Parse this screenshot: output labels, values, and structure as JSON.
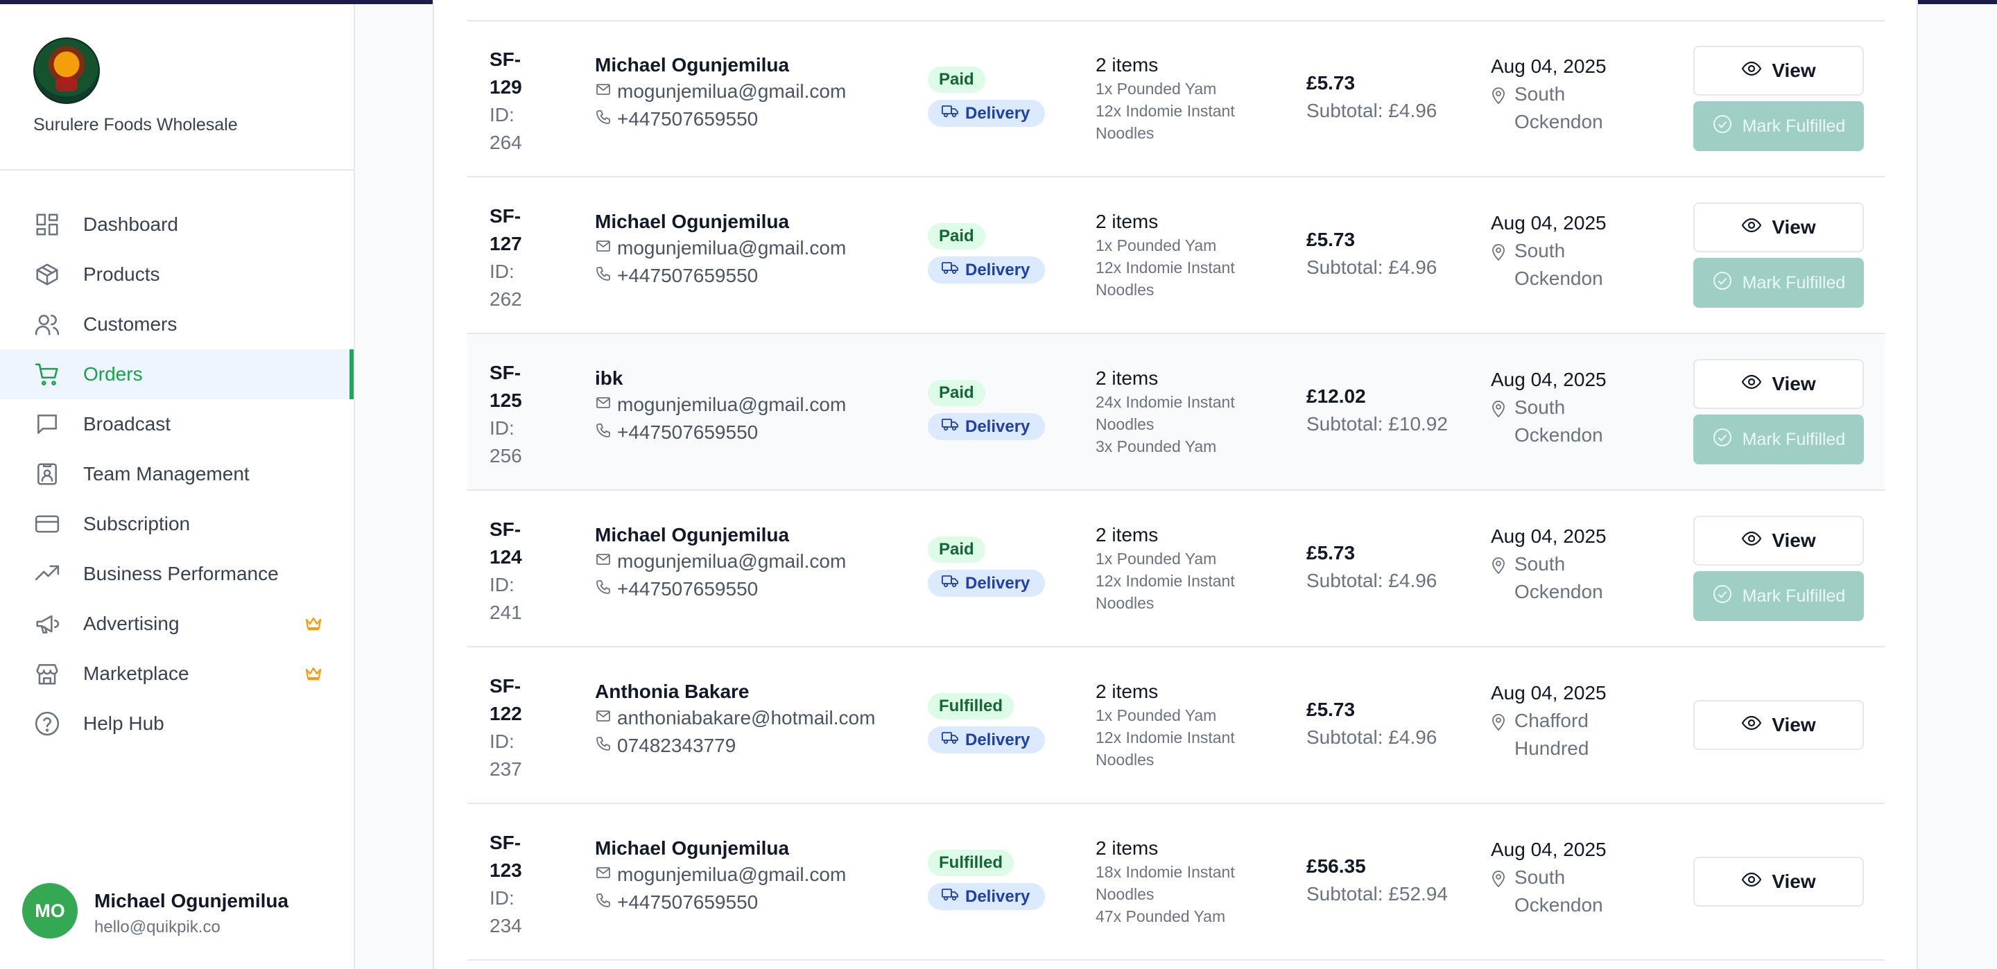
{
  "brand": {
    "name": "Surulere Foods Wholesale"
  },
  "nav": [
    {
      "key": "dashboard",
      "label": "Dashboard",
      "icon": "dashboard-icon"
    },
    {
      "key": "products",
      "label": "Products",
      "icon": "box-icon"
    },
    {
      "key": "customers",
      "label": "Customers",
      "icon": "users-icon"
    },
    {
      "key": "orders",
      "label": "Orders",
      "icon": "cart-icon",
      "active": true
    },
    {
      "key": "broadcast",
      "label": "Broadcast",
      "icon": "message-icon"
    },
    {
      "key": "team",
      "label": "Team Management",
      "icon": "id-badge-icon"
    },
    {
      "key": "subscription",
      "label": "Subscription",
      "icon": "credit-card-icon"
    },
    {
      "key": "performance",
      "label": "Business Performance",
      "icon": "trending-up-icon"
    },
    {
      "key": "advertising",
      "label": "Advertising",
      "icon": "megaphone-icon",
      "premium": true
    },
    {
      "key": "marketplace",
      "label": "Marketplace",
      "icon": "store-icon",
      "premium": true
    },
    {
      "key": "help",
      "label": "Help Hub",
      "icon": "help-circle-icon"
    }
  ],
  "user": {
    "initials": "MO",
    "name": "Michael Ogunjemilua",
    "email": "hello@quikpik.co"
  },
  "buttons": {
    "view": "View",
    "mark_fulfilled": "Mark Fulfilled"
  },
  "orders": [
    {
      "num": "SF-129",
      "id": "ID: 264",
      "customer": "Michael Ogunjemilua",
      "email": "mogunjemilua@gmail.com",
      "phone": "+447507659550",
      "status": "Paid",
      "delivery": "Delivery",
      "items_count": "2 items",
      "items": [
        "1x Pounded Yam",
        "12x Indomie Instant Noodles"
      ],
      "total": "£5.73",
      "subtotal": "Subtotal: £4.96",
      "date": "Aug 04, 2025",
      "location": "South Ockendon",
      "can_fulfill": true
    },
    {
      "num": "SF-127",
      "id": "ID: 262",
      "customer": "Michael Ogunjemilua",
      "email": "mogunjemilua@gmail.com",
      "phone": "+447507659550",
      "status": "Paid",
      "delivery": "Delivery",
      "items_count": "2 items",
      "items": [
        "1x Pounded Yam",
        "12x Indomie Instant Noodles"
      ],
      "total": "£5.73",
      "subtotal": "Subtotal: £4.96",
      "date": "Aug 04, 2025",
      "location": "South Ockendon",
      "can_fulfill": true
    },
    {
      "num": "SF-125",
      "id": "ID: 256",
      "customer": "ibk",
      "email": "mogunjemilua@gmail.com",
      "phone": "+447507659550",
      "status": "Paid",
      "delivery": "Delivery",
      "items_count": "2 items",
      "items": [
        "24x Indomie Instant Noodles",
        "3x Pounded Yam"
      ],
      "total": "£12.02",
      "subtotal": "Subtotal: £10.92",
      "date": "Aug 04, 2025",
      "location": "South Ockendon",
      "can_fulfill": true,
      "highlighted": true
    },
    {
      "num": "SF-124",
      "id": "ID: 241",
      "customer": "Michael Ogunjemilua",
      "email": "mogunjemilua@gmail.com",
      "phone": "+447507659550",
      "status": "Paid",
      "delivery": "Delivery",
      "items_count": "2 items",
      "items": [
        "1x Pounded Yam",
        "12x Indomie Instant Noodles"
      ],
      "total": "£5.73",
      "subtotal": "Subtotal: £4.96",
      "date": "Aug 04, 2025",
      "location": "South Ockendon",
      "can_fulfill": true
    },
    {
      "num": "SF-122",
      "id": "ID: 237",
      "customer": "Anthonia Bakare",
      "email": "anthoniabakare@hotmail.com",
      "phone": "07482343779",
      "status": "Fulfilled",
      "delivery": "Delivery",
      "items_count": "2 items",
      "items": [
        "1x Pounded Yam",
        "12x Indomie Instant Noodles"
      ],
      "total": "£5.73",
      "subtotal": "Subtotal: £4.96",
      "date": "Aug 04, 2025",
      "location": "Chafford Hundred",
      "can_fulfill": false
    },
    {
      "num": "SF-123",
      "id": "ID: 234",
      "customer": "Michael Ogunjemilua",
      "email": "mogunjemilua@gmail.com",
      "phone": "+447507659550",
      "status": "Fulfilled",
      "delivery": "Delivery",
      "items_count": "2 items",
      "items": [
        "18x Indomie Instant Noodles",
        "47x Pounded Yam"
      ],
      "total": "£56.35",
      "subtotal": "Subtotal: £52.94",
      "date": "Aug 04, 2025",
      "location": "South Ockendon",
      "can_fulfill": false
    }
  ],
  "colors": {
    "accent": "#22a45d",
    "fulfill_button": "#9fcfc4",
    "paid_badge": "#dcfce7",
    "delivery_badge": "#dbeafe"
  }
}
